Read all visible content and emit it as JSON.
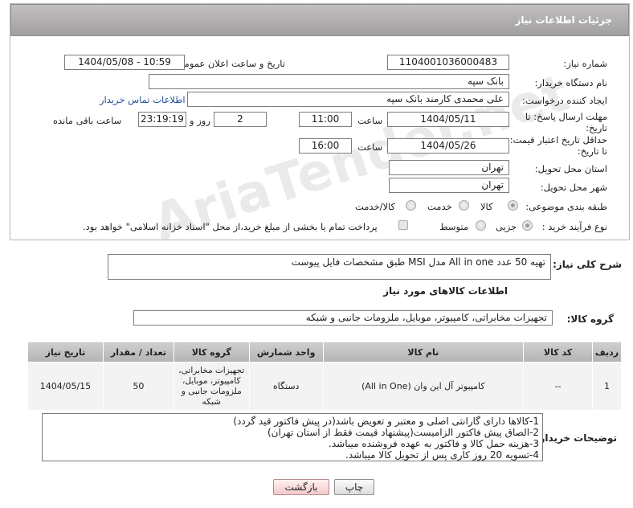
{
  "header": {
    "title": "جزئیات اطلاعات نیاز"
  },
  "form": {
    "need_number_label": "شماره نیاز:",
    "need_number": "1104001036000483",
    "announce_label": "تاریخ و ساعت اعلان عمومی:",
    "announce_value": "1404/05/08 - 10:59",
    "buyer_org_label": "نام دستگاه خریدار:",
    "buyer_org": "بانک سپه",
    "requester_label": "ایجاد کننده درخواست:",
    "requester": "علی محمدی کارمند بانک سپه",
    "contact_link": "اطلاعات تماس خریدار",
    "deadline_label": "مهلت ارسال پاسخ: تا تاریخ:",
    "deadline_date": "1404/05/11",
    "time_label": "ساعت",
    "deadline_time": "11:00",
    "days_value": "2",
    "days_label": "روز و",
    "remaining_time": "23:19:19",
    "remaining_label": "ساعت باقی مانده",
    "validity_label": "حداقل تاریخ اعتبار قیمت: تا تاریخ:",
    "validity_date": "1404/05/26",
    "validity_time_label": "ساعت",
    "validity_time": "16:00",
    "province_label": "استان محل تحویل:",
    "province": "تهران",
    "city_label": "شهر محل تحویل:",
    "city": "تهران",
    "category_label": "طبقه بندی موضوعی:",
    "category_options": [
      "کالا",
      "خدمت",
      "کالا/خدمت"
    ],
    "category_selected": "کالا",
    "process_label": "نوع فرآیند خرید :",
    "process_options": [
      "جزیی",
      "متوسط"
    ],
    "process_selected": "جزیی",
    "payment_note": "پرداخت تمام یا بخشی از مبلغ خرید،از محل \"اسناد خزانه اسلامی\" خواهد بود."
  },
  "description": {
    "label": "شرح کلی نیاز:",
    "text": "تهیه 50 عدد All in one مدل MSI طبق مشخصات فایل پیوست"
  },
  "goods_info": {
    "title": "اطلاعات کالاهای مورد نیاز",
    "group_label": "گروه کالا:",
    "group_value": "تجهیزات مخابراتی، کامپیوتر، موبایل، ملزومات جانبی و شبکه"
  },
  "table": {
    "headers": [
      "ردیف",
      "کد کالا",
      "نام کالا",
      "واحد شمارش",
      "گروه کالا",
      "تعداد / مقدار",
      "تاریخ نیاز"
    ],
    "rows": [
      [
        "1",
        "--",
        "کامپیوتر آل این وان (All in One)",
        "دستگاه",
        "تجهیزات مخابراتی، کامپیوتر، موبایل، ملزومات جانبی و شبکه",
        "50",
        "1404/05/15"
      ]
    ]
  },
  "notes": {
    "label": "توضیحات خریدار:",
    "lines": [
      "1-کالاها دارای گارانتی اصلی و  معتبر و تعویض باشد(در پیش فاکتور قید گردد)",
      "2-الصاق پیش فاکتور الزامیست(پیشنهاد قیمت فقط از استان تهران)",
      "3-هزینه حمل کالا و فاکتور به عهده فروشنده میباشد.",
      "4-تسویه 20 روز کاری پس از تحویل کالا میباشد."
    ]
  },
  "buttons": {
    "print": "چاپ",
    "back": "بازگشت"
  },
  "colors": {
    "header_bg": "#a9a7a7",
    "link": "#1f4f9c",
    "back_button": "#f3c9c9"
  }
}
